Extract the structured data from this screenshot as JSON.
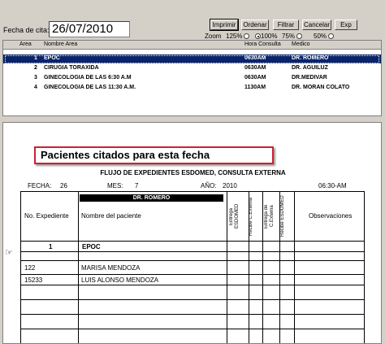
{
  "toolbar": {
    "fecha_label": "Fecha de cita:",
    "fecha_value": "26/07/2010",
    "imprimir": "Imprimir",
    "ordenar": "Ordenar",
    "filtrar": "Filtrar",
    "cancelar": "Cancelar",
    "exp": "Exp"
  },
  "zoom": {
    "label": "Zoom",
    "options": [
      "125%",
      "100%",
      "75%",
      "50%"
    ],
    "selected": "100%"
  },
  "grid": {
    "headers": [
      "Area",
      "Nombre Area",
      "Hora Consulta",
      "Medico"
    ],
    "rows": [
      {
        "area": "1",
        "nombre": "EPOC",
        "hora": "0630AM",
        "medico": "DR. ROMERO"
      },
      {
        "area": "2",
        "nombre": "CIRUGIA TORAXIDA",
        "hora": "0630AM",
        "medico": "DR. AGUILUZ"
      },
      {
        "area": "3",
        "nombre": "GINECOLOGIA DE LAS 6:30 A.M",
        "hora": "0630AM",
        "medico": "DR.MEDIVAR"
      },
      {
        "area": "4",
        "nombre": "GINECOLOGIA DE LAS 11:30 A.M.",
        "hora": "1130AM",
        "medico": "DR. MORAN COLATO"
      }
    ]
  },
  "report": {
    "banner": "Pacientes citados para esta fecha",
    "title": "FLUJO DE EXPEDIENTES ESDOMED, CONSULTA EXTERNA",
    "fecha_label": "FECHA:",
    "dia": "26",
    "mes_label": "MES:",
    "mes": "7",
    "anio_label": "AÑO:",
    "anio": "2010",
    "hora": "06:30-AM",
    "doctor": "DR. ROMERO",
    "col_expediente": "No. Expediente",
    "col_nombre": "Nombre del paciente",
    "col_entrega1": "Entrega ESDOMED",
    "col_recibe1": "Recibe C.Externa",
    "col_entrega2": "Entrega de C.Externa",
    "col_recibe2": "Recibe ESDOMED",
    "col_observaciones": "Observaciones",
    "group_num": "1",
    "group_name": "EPOC",
    "patients": [
      {
        "exp": "122",
        "nombre": "MARISA MENDOZA"
      },
      {
        "exp": "15233",
        "nombre": "LUIS ALONSO MENDOZA"
      }
    ]
  },
  "colors": {
    "selection": "#0a246a",
    "banner_border": "#cc2233",
    "window": "#d4d0c8"
  },
  "icons": {
    "pointer": "pointing-hand-icon"
  }
}
